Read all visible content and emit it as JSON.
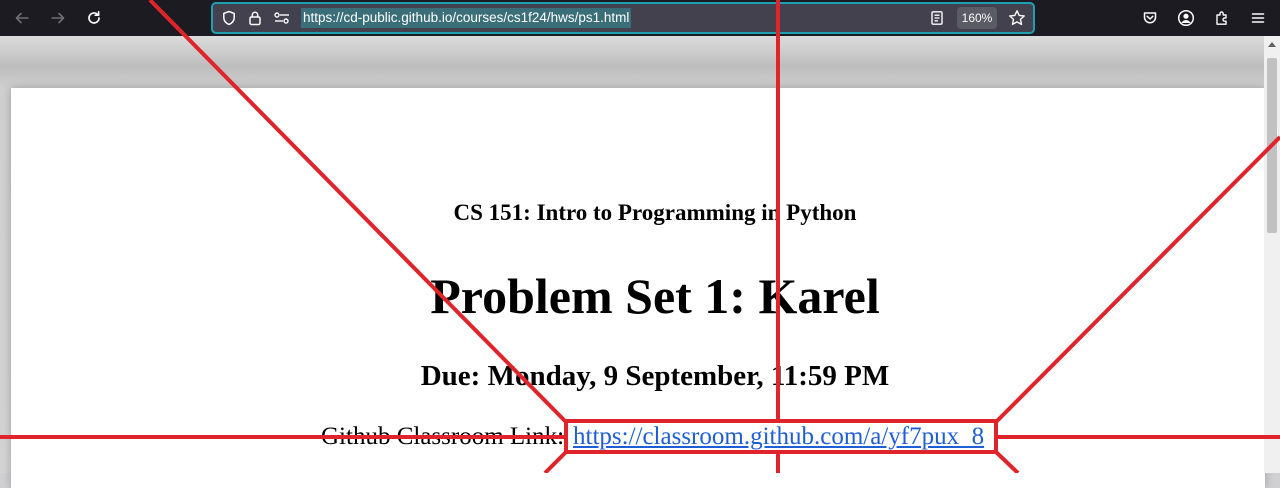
{
  "browser": {
    "url": "https://cd-public.github.io/courses/cs1f24/hws/ps1.html",
    "zoom": "160%",
    "icons": {
      "back": "back-arrow-icon",
      "forward": "forward-arrow-icon",
      "reload": "reload-icon",
      "shield": "tracking-protection-shield-icon",
      "lock": "lock-icon",
      "permissions": "permissions-icon",
      "reader": "reader-view-icon",
      "bookmark": "star-icon",
      "pocket": "pocket-icon",
      "account": "account-icon",
      "extensions": "extensions-icon",
      "menu": "hamburger-menu-icon"
    },
    "colors": {
      "toolbar": "#1c1b22",
      "urlbar": "#42414d",
      "urlbar_focus": "#1fa0b0",
      "annotation": "#e0242c",
      "link": "#1f5fd6"
    }
  },
  "page": {
    "course_title": "CS 151: Intro to Programming in Python",
    "title": "Problem Set 1: Karel",
    "due": "Due: Monday, 9 September, 11:59 PM",
    "github_label": "Github Classroom Link:",
    "github_link": "https://classroom.github.com/a/yf7pux_8"
  }
}
